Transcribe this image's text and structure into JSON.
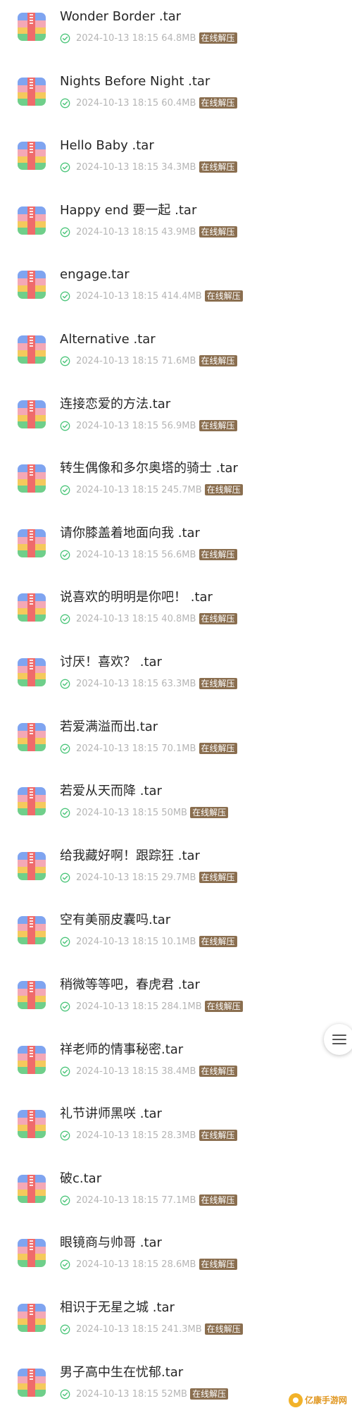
{
  "colors": {
    "name_text": "#262626",
    "meta_text": "#b5b5b5",
    "check_green": "#4cc57a",
    "badge_bg": "#8a6e4f",
    "badge_text": "#ffffff"
  },
  "file_icon": "zip-archive-icon",
  "status_icon": "check-circle-icon",
  "files": [
    {
      "name": "Wonder Border .tar",
      "date": "2024-10-13 18:15",
      "size": "64.8MB",
      "action": "在线解压"
    },
    {
      "name": "Nights Before Night .tar",
      "date": "2024-10-13 18:15",
      "size": "60.4MB",
      "action": "在线解压"
    },
    {
      "name": "Hello Baby .tar",
      "date": "2024-10-13 18:15",
      "size": "34.3MB",
      "action": "在线解压"
    },
    {
      "name": "Happy end 要一起 .tar",
      "date": "2024-10-13 18:15",
      "size": "43.9MB",
      "action": "在线解压"
    },
    {
      "name": "engage.tar",
      "date": "2024-10-13 18:15",
      "size": "414.4MB",
      "action": "在线解压"
    },
    {
      "name": "Alternative .tar",
      "date": "2024-10-13 18:15",
      "size": "71.6MB",
      "action": "在线解压"
    },
    {
      "name": "连接恋爱的方法.tar",
      "date": "2024-10-13 18:15",
      "size": "56.9MB",
      "action": "在线解压"
    },
    {
      "name": "转生偶像和多尔奥塔的骑士 .tar",
      "date": "2024-10-13 18:15",
      "size": "245.7MB",
      "action": "在线解压"
    },
    {
      "name": "请你膝盖着地面向我 .tar",
      "date": "2024-10-13 18:15",
      "size": "56.6MB",
      "action": "在线解压"
    },
    {
      "name": "说喜欢的明明是你吧！ .tar",
      "date": "2024-10-13 18:15",
      "size": "40.8MB",
      "action": "在线解压"
    },
    {
      "name": "讨厌！喜欢？ .tar",
      "date": "2024-10-13 18:15",
      "size": "63.3MB",
      "action": "在线解压"
    },
    {
      "name": "若爱满溢而出.tar",
      "date": "2024-10-13 18:15",
      "size": "70.1MB",
      "action": "在线解压"
    },
    {
      "name": "若爱从天而降 .tar",
      "date": "2024-10-13 18:15",
      "size": "50MB",
      "action": "在线解压"
    },
    {
      "name": "给我藏好啊！跟踪狂 .tar",
      "date": "2024-10-13 18:15",
      "size": "29.7MB",
      "action": "在线解压"
    },
    {
      "name": "空有美丽皮囊吗.tar",
      "date": "2024-10-13 18:15",
      "size": "10.1MB",
      "action": "在线解压"
    },
    {
      "name": "稍微等等吧，春虎君 .tar",
      "date": "2024-10-13 18:15",
      "size": "284.1MB",
      "action": "在线解压"
    },
    {
      "name": "祥老师的情事秘密.tar",
      "date": "2024-10-13 18:15",
      "size": "38.4MB",
      "action": "在线解压"
    },
    {
      "name": "礼节讲师黑咲 .tar",
      "date": "2024-10-13 18:15",
      "size": "28.3MB",
      "action": "在线解压"
    },
    {
      "name": "破c.tar",
      "date": "2024-10-13 18:15",
      "size": "77.1MB",
      "action": "在线解压"
    },
    {
      "name": "眼镜商与帅哥 .tar",
      "date": "2024-10-13 18:15",
      "size": "28.6MB",
      "action": "在线解压"
    },
    {
      "name": "相识于无星之城 .tar",
      "date": "2024-10-13 18:15",
      "size": "241.3MB",
      "action": "在线解压"
    },
    {
      "name": "男子高中生在忧郁.tar",
      "date": "2024-10-13 18:15",
      "size": "52MB",
      "action": "在线解压"
    }
  ],
  "floating_menu": {
    "icon": "menu-icon"
  },
  "watermark": {
    "text": "亿康手游网"
  }
}
